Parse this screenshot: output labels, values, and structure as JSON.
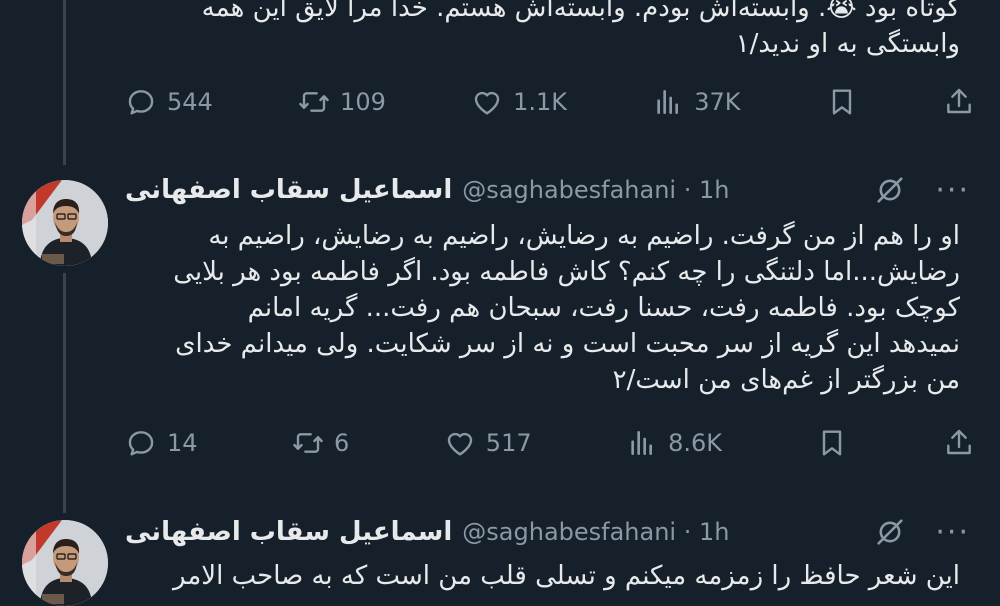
{
  "tweet1": {
    "text": "کوتاه بود 😭. وابسته‌اش بودم. وابسته‌اش هستم. خدا مرا لایق این همه\nوابستگی به او ندید/۱",
    "replies": "544",
    "retweets": "109",
    "likes": "1.1K",
    "views": "37K"
  },
  "tweet2": {
    "name": "اسماعیل سقاب اصفهانی",
    "handle": "@saghabesfahani · 1h",
    "text": "او را هم از من گرفت. راضیم به رضایش، راضیم به رضایش، راضیم به\nرضایش...اما دلتنگی را چه کنم؟ کاش فاطمه بود. اگر فاطمه بود هر بلایی\nکوچک بود. فاطمه رفت، حسنا رفت، سبحان هم رفت... گریه امانم\nنمیدهد این گریه از سر محبت است و نه از سر شکایت. ولی میدانم خدای\nمن بزرگتر از غم‌های من است/۲",
    "replies": "14",
    "retweets": "6",
    "likes": "517",
    "views": "8.6K"
  },
  "tweet3": {
    "name": "اسماعیل سقاب اصفهانی",
    "handle": "@saghabesfahani · 1h",
    "text": "این شعر حافظ  را زمزمه میکنم و تسلی قلب من است که به صاحب الامر"
  },
  "icons": {
    "reply": "reply-icon",
    "retweet": "retweet-icon",
    "like": "heart-icon",
    "views": "views-icon",
    "bookmark": "bookmark-icon",
    "share": "share-icon",
    "grok": "grok-icon",
    "more": "more-icon"
  },
  "colors": {
    "background": "#15202b",
    "text": "#e7e9ea",
    "muted": "#8b98a5"
  }
}
